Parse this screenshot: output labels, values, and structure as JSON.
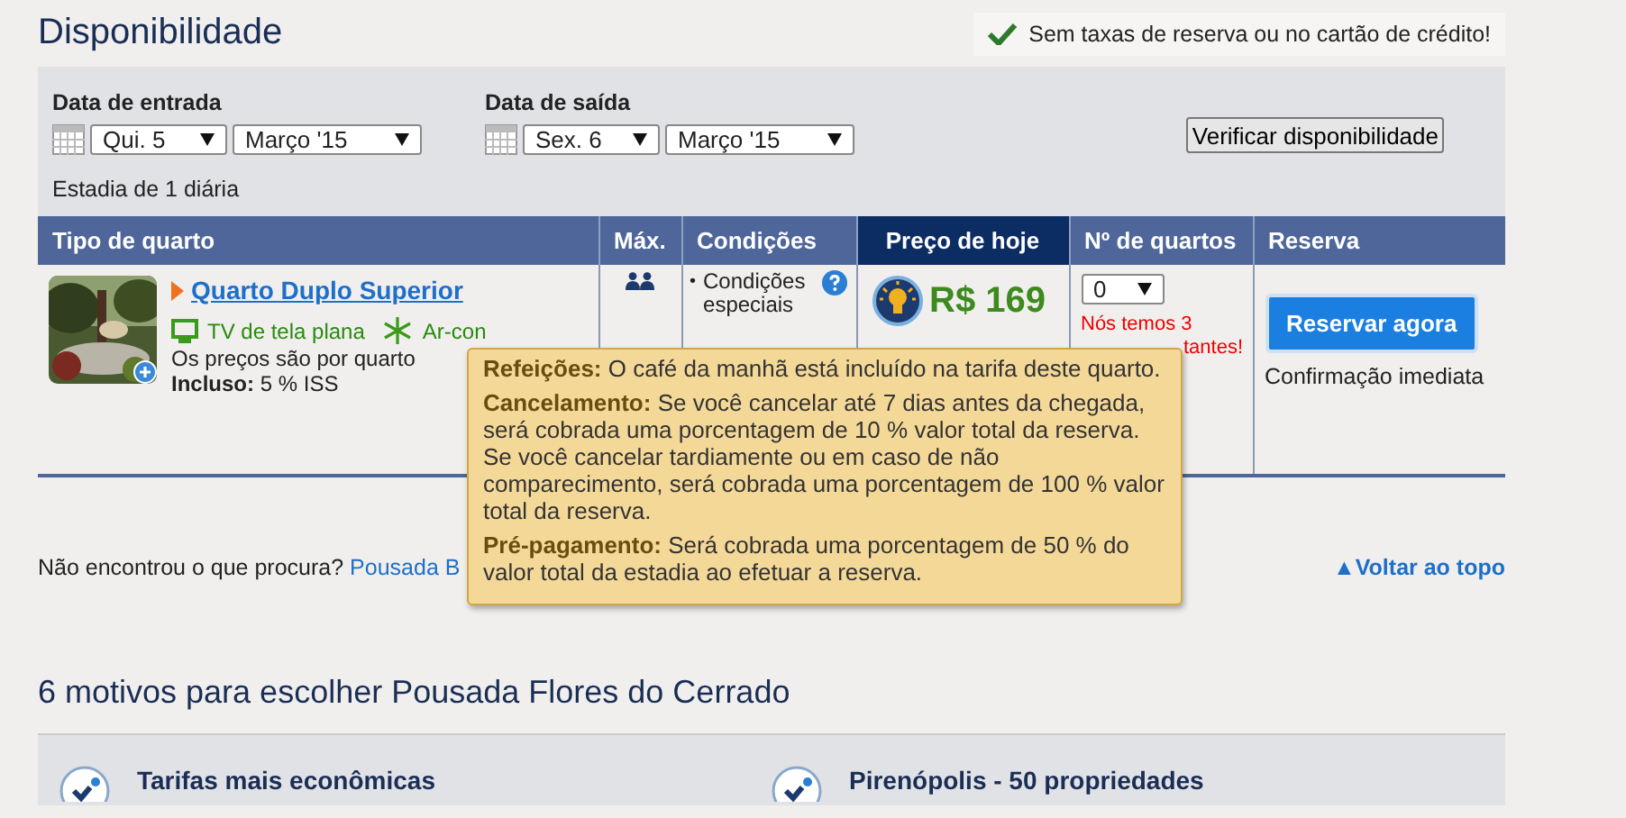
{
  "title": "Disponibilidade",
  "notice": {
    "text": "Sem taxas de reserva ou no cartão de crédito!"
  },
  "search": {
    "dates": [
      {
        "label": "Data de entrada",
        "day": "Qui. 5",
        "month": "Março '15"
      },
      {
        "label": "Data de saída",
        "day": "Sex. 6",
        "month": "Março '15"
      }
    ],
    "stay": "Estadia de 1 diária",
    "button": "Verificar disponibilidade"
  },
  "table": {
    "columns": [
      {
        "label": "Tipo de quarto",
        "highlighted": false
      },
      {
        "label": "Máx.",
        "highlighted": false
      },
      {
        "label": "Condições",
        "highlighted": false
      },
      {
        "label": "Preço de hoje",
        "highlighted": true
      },
      {
        "label": "Nº de quartos",
        "highlighted": false
      },
      {
        "label": "Reserva",
        "highlighted": false
      }
    ],
    "rows": [
      {
        "name": "Quarto Duplo Superior",
        "amenities": [
          {
            "kind": "tv",
            "label": "TV de tela plana"
          },
          {
            "kind": "ac",
            "label": "Ar-con"
          }
        ],
        "price_note": "Os preços são por quarto",
        "included": "**Incluso:** 5 % ISS",
        "conditions_bullet": "•",
        "conditions": "Condições especiais",
        "price": "R$ 169",
        "quantity": "0",
        "availability": "Nós temos 3",
        "availability_tail": "tantes!",
        "button": "Reservar agora",
        "confirmation": "Confirmação imediata"
      }
    ]
  },
  "tooltip": {
    "paragraphs": [
      "**Refeições:** O café da manhã está incluído na tarifa deste quarto.",
      "**Cancelamento:** Se você cancelar até 7 dias antes da chegada, será cobrada uma porcentagem de 10 % valor total da reserva. Se você cancelar tardiamente ou em caso de não comparecimento, será cobrada uma porcentagem de 100 % valor total da reserva.",
      "**Pré-pagamento:** Será cobrada uma porcentagem de 50 % do valor total da estadia ao efetuar a reserva."
    ]
  },
  "footer": {
    "text": "Não encontrou o que procura?",
    "link": "Pousada B",
    "back_to_top": "▲Voltar ao topo"
  },
  "reasons": {
    "title": "6 motivos para escolher Pousada Flores do Cerrado",
    "items": [
      {
        "title": "Tarifas mais econômicas"
      },
      {
        "title": "Pirenópolis - 50 propriedades"
      }
    ]
  }
}
